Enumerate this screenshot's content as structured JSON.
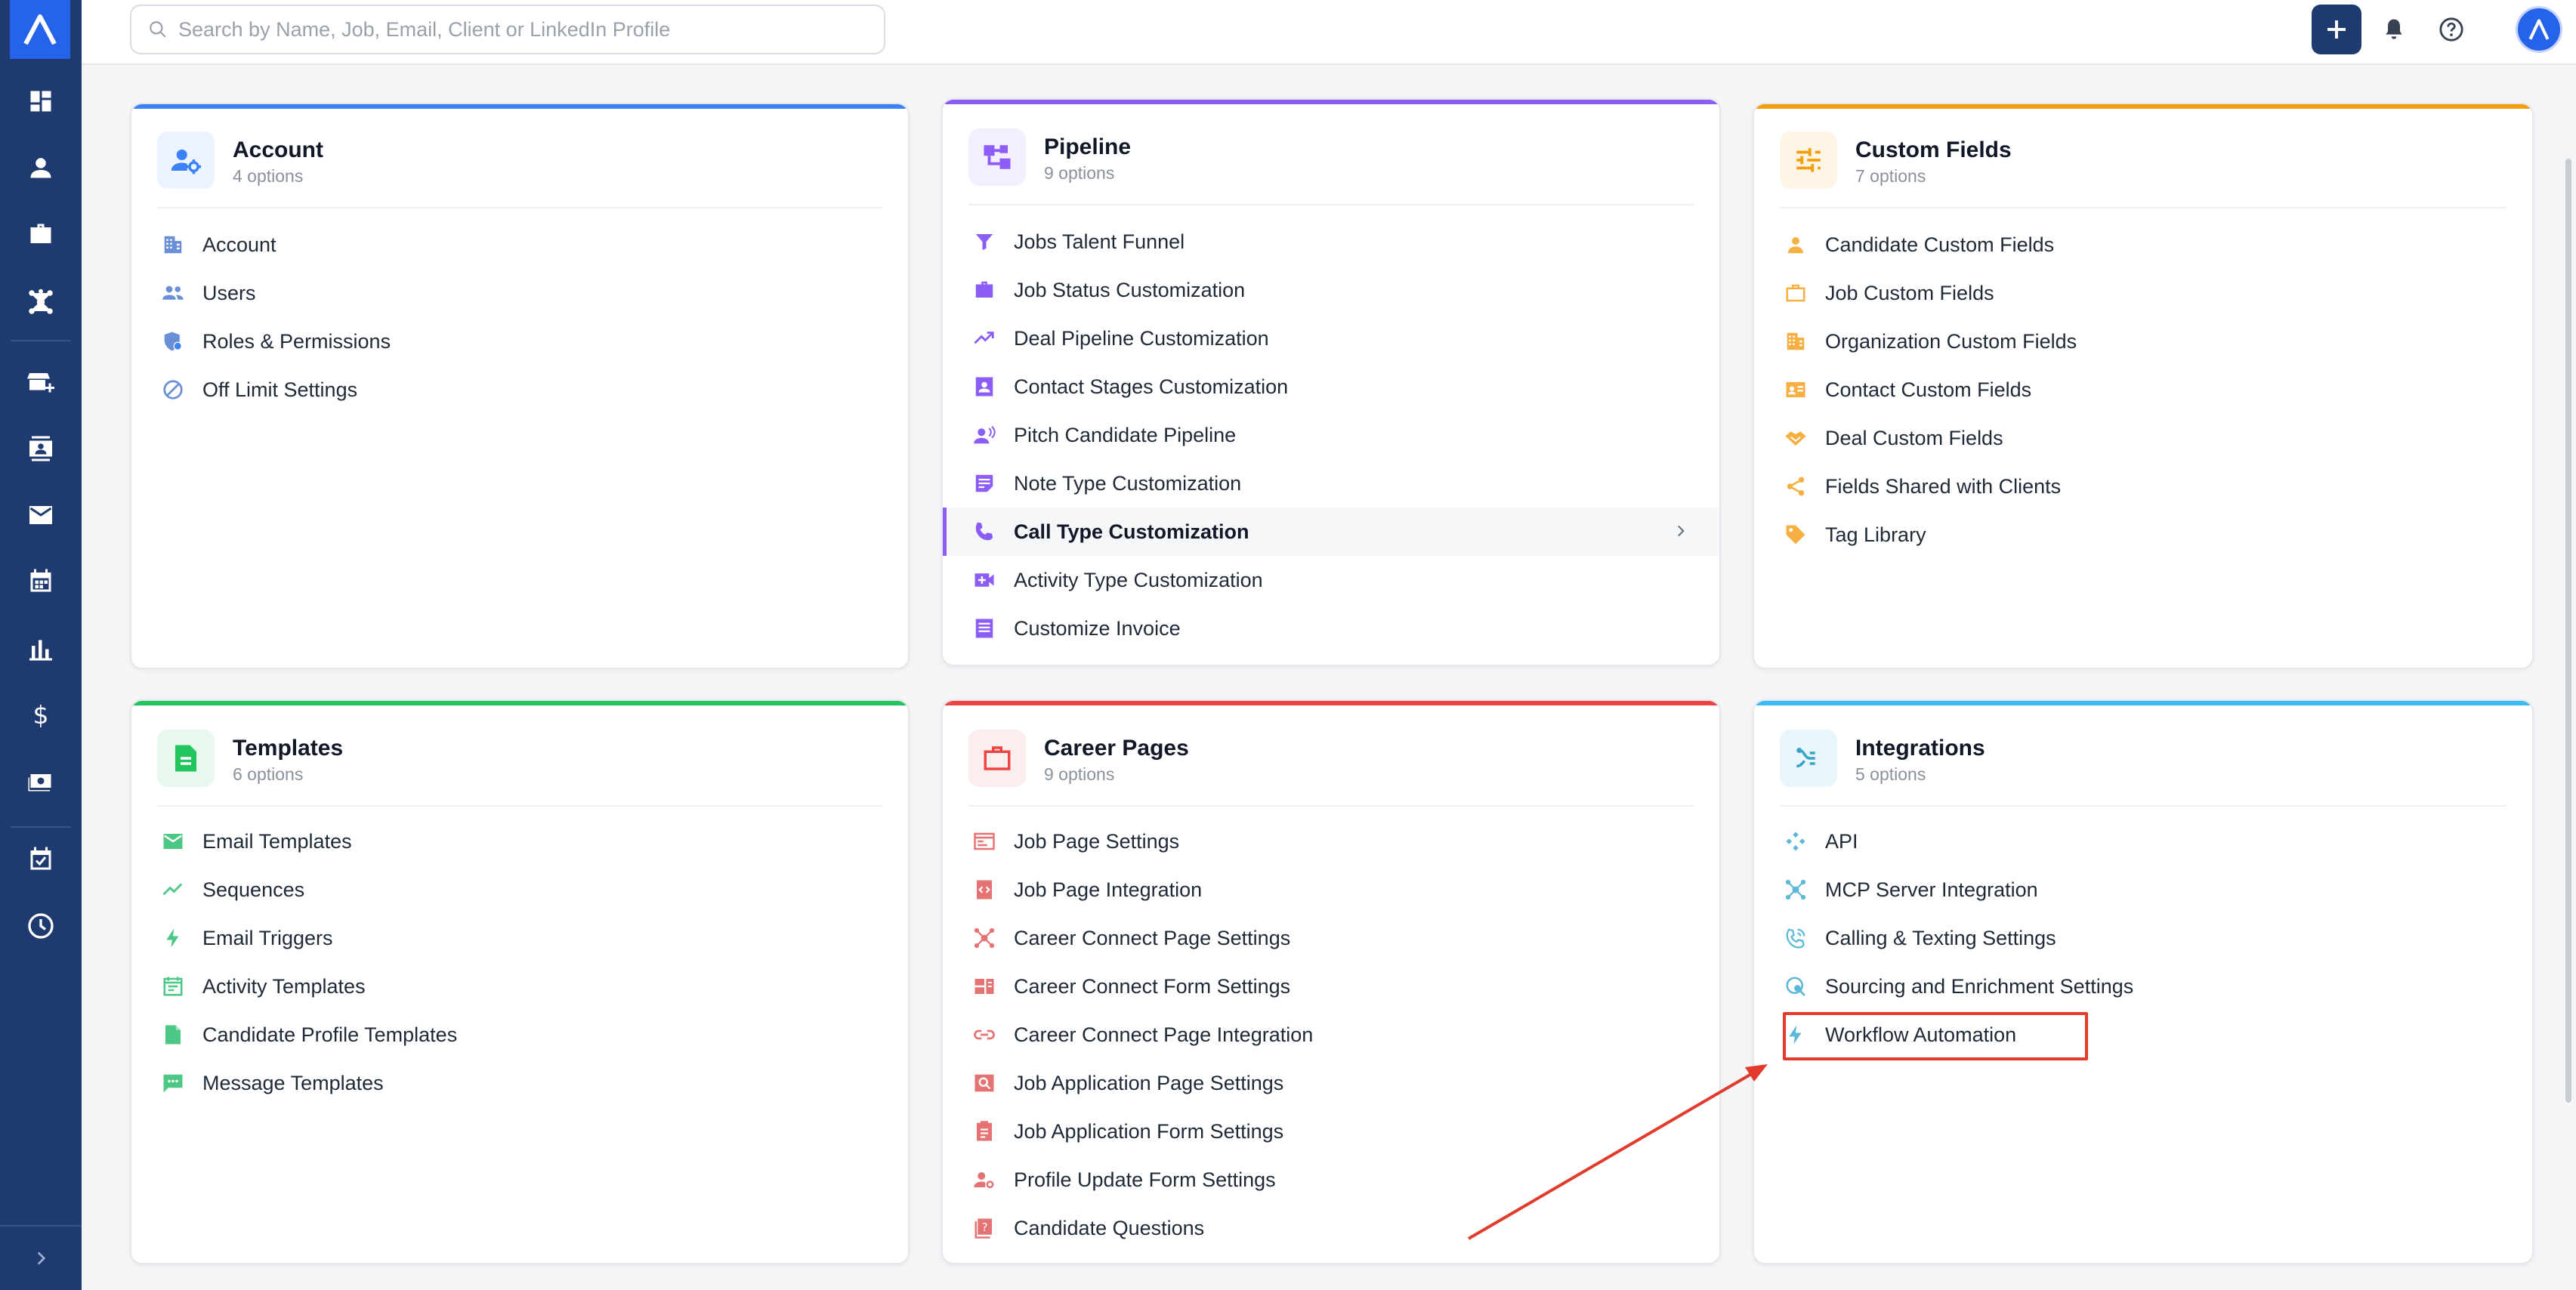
{
  "search": {
    "placeholder": "Search by Name, Job, Email, Client or LinkedIn Profile"
  },
  "sidebar": {
    "icons": [
      "dashboard-icon",
      "person-icon",
      "briefcase-icon",
      "network-icon",
      "store-add-icon",
      "contact-card-icon",
      "mail-icon",
      "calendar-icon",
      "bar-chart-icon",
      "dollar-icon",
      "money-icon",
      "task-calendar-icon",
      "clock-icon"
    ]
  },
  "cards": [
    {
      "title": "Account",
      "subtitle": "4 options",
      "accent": "#3b82f6",
      "items": [
        "Account",
        "Users",
        "Roles & Permissions",
        "Off Limit Settings"
      ]
    },
    {
      "title": "Pipeline",
      "subtitle": "9 options",
      "accent": "#8b5cf6",
      "items": [
        "Jobs Talent Funnel",
        "Job Status Customization",
        "Deal Pipeline Customization",
        "Contact Stages Customization",
        "Pitch Candidate Pipeline",
        "Note Type Customization",
        "Call Type Customization",
        "Activity Type Customization",
        "Customize Invoice"
      ],
      "active_item": "Call Type Customization"
    },
    {
      "title": "Custom Fields",
      "subtitle": "7 options",
      "accent": "#f59e0b",
      "items": [
        "Candidate Custom Fields",
        "Job Custom Fields",
        "Organization Custom Fields",
        "Contact Custom Fields",
        "Deal Custom Fields",
        "Fields Shared with Clients",
        "Tag Library"
      ]
    },
    {
      "title": "Templates",
      "subtitle": "6 options",
      "accent": "#22c55e",
      "items": [
        "Email Templates",
        "Sequences",
        "Email Triggers",
        "Activity Templates",
        "Candidate Profile Templates",
        "Message Templates"
      ]
    },
    {
      "title": "Career Pages",
      "subtitle": "9 options",
      "accent": "#ef4444",
      "items": [
        "Job Page Settings",
        "Job Page Integration",
        "Career Connect Page Settings",
        "Career Connect Form Settings",
        "Career Connect Page Integration",
        "Job Application Page Settings",
        "Job Application Form Settings",
        "Profile Update Form Settings",
        "Candidate Questions"
      ]
    },
    {
      "title": "Integrations",
      "subtitle": "5 options",
      "accent": "#38bdf8",
      "items": [
        "API",
        "MCP Server Integration",
        "Calling & Texting Settings",
        "Sourcing and Enrichment Settings",
        "Workflow Automation"
      ],
      "highlighted_item": "Workflow Automation"
    }
  ]
}
